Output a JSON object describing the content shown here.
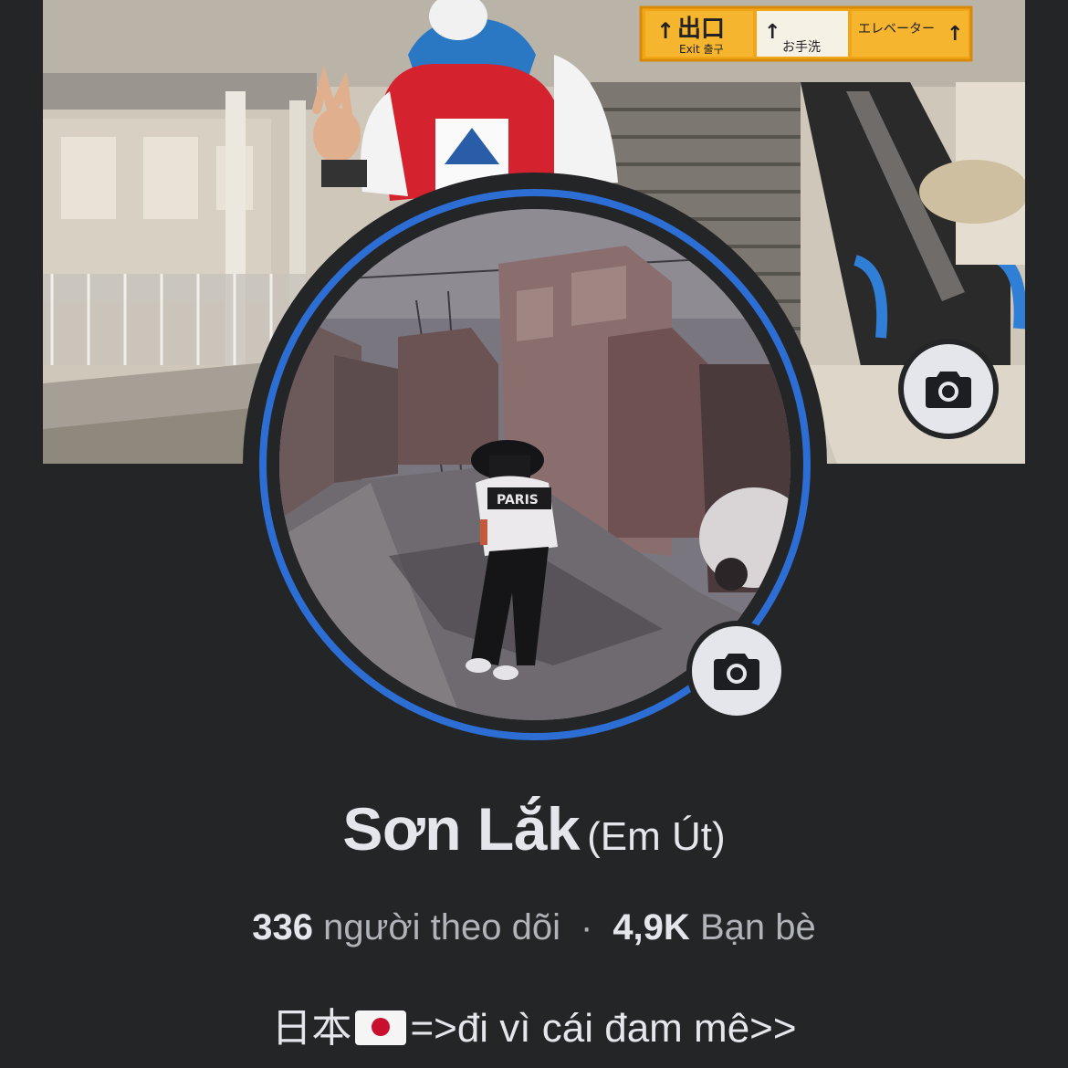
{
  "profile": {
    "name": "Sơn Lắk",
    "alternate_name": "(Em Út)",
    "followers_count": "336",
    "followers_label": "người theo dõi",
    "separator": "·",
    "friends_count": "4,9K",
    "friends_label": "Bạn bè",
    "bio_prefix": "日本",
    "bio_flag": "japan-flag-icon",
    "bio_suffix": "=>đi vì cái đam mê>>"
  },
  "cover_photo": {
    "sign_exit": "出口",
    "sign_exit_en": "Exit 출구",
    "sign_toilets": "お手洗",
    "sign_elevator": "エレベーター"
  },
  "avatar_photo": {
    "shirt_text": "PARIS"
  },
  "icons": {
    "cover_camera": "camera-icon",
    "avatar_camera": "camera-icon"
  },
  "colors": {
    "background": "#242526",
    "ring": "#2d6ed4",
    "primary_text": "#e4e6eb",
    "secondary_text": "#b0b3b8",
    "button_bg": "#e4e6eb"
  }
}
